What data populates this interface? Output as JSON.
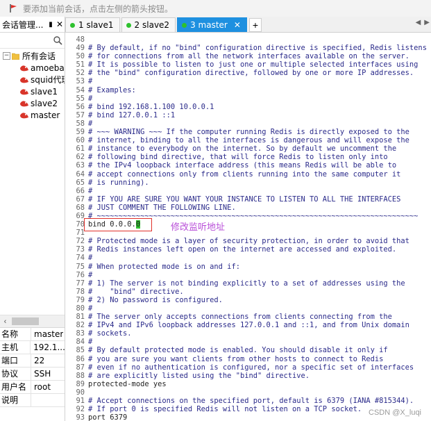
{
  "hint_bar": {
    "text": "要添加当前会话，点击左侧的箭头按钮。",
    "icon": "flag-arrow-icon"
  },
  "session_panel": {
    "title": "会话管理...",
    "pin_icon": "pin-icon",
    "close_icon": "close-icon",
    "search": {
      "value": "",
      "placeholder": ""
    },
    "tree": {
      "root": "所有会话",
      "items": [
        "amoeba",
        "squid代理",
        "slave1",
        "slave2",
        "master"
      ]
    }
  },
  "properties": [
    {
      "key": "名称",
      "value": "master"
    },
    {
      "key": "主机",
      "value": "192.1..."
    },
    {
      "key": "端口",
      "value": "22"
    },
    {
      "key": "协议",
      "value": "SSH"
    },
    {
      "key": "用户名",
      "value": "root"
    },
    {
      "key": "说明",
      "value": ""
    }
  ],
  "tabs": [
    {
      "number": "1",
      "label": "slave1",
      "active": false
    },
    {
      "number": "2",
      "label": "slave2",
      "active": false
    },
    {
      "number": "3",
      "label": "master",
      "active": true
    }
  ],
  "tab_add": "+",
  "editor": {
    "lines": [
      {
        "n": "48",
        "t": ""
      },
      {
        "n": "49",
        "t": "# By default, if no \"bind\" configuration directive is specified, Redis listens"
      },
      {
        "n": "50",
        "t": "# for connections from all the network interfaces available on the server."
      },
      {
        "n": "51",
        "t": "# It is possible to listen to just one or multiple selected interfaces using"
      },
      {
        "n": "52",
        "t": "# the \"bind\" configuration directive, followed by one or more IP addresses."
      },
      {
        "n": "53",
        "t": "#"
      },
      {
        "n": "54",
        "t": "# Examples:"
      },
      {
        "n": "55",
        "t": "#"
      },
      {
        "n": "56",
        "t": "# bind 192.168.1.100 10.0.0.1"
      },
      {
        "n": "57",
        "t": "# bind 127.0.0.1 ::1"
      },
      {
        "n": "58",
        "t": "#"
      },
      {
        "n": "59",
        "t": "# ~~~ WARNING ~~~ If the computer running Redis is directly exposed to the"
      },
      {
        "n": "60",
        "t": "# internet, binding to all the interfaces is dangerous and will expose the"
      },
      {
        "n": "61",
        "t": "# instance to everybody on the internet. So by default we uncomment the"
      },
      {
        "n": "62",
        "t": "# following bind directive, that will force Redis to listen only into"
      },
      {
        "n": "63",
        "t": "# the IPv4 loopback interface address (this means Redis will be able to"
      },
      {
        "n": "64",
        "t": "# accept connections only from clients running into the same computer it"
      },
      {
        "n": "65",
        "t": "# is running)."
      },
      {
        "n": "66",
        "t": "#"
      },
      {
        "n": "67",
        "t": "# IF YOU ARE SURE YOU WANT YOUR INSTANCE TO LISTEN TO ALL THE INTERFACES"
      },
      {
        "n": "68",
        "t": "# JUST COMMENT THE FOLLOWING LINE."
      },
      {
        "n": "69",
        "t": "# ~~~~~~~~~~~~~~~~~~~~~~~~~~~~~~~~~~~~~~~~~~~~~~~~~~~~~~~~~~~~~~~~~~~~~~~~~~"
      },
      {
        "n": "70",
        "t": "bind 0.0.0.",
        "cursor": "0"
      },
      {
        "n": "71",
        "t": ""
      },
      {
        "n": "72",
        "t": "# Protected mode is a layer of security protection, in order to avoid that"
      },
      {
        "n": "73",
        "t": "# Redis instances left open on the internet are accessed and exploited."
      },
      {
        "n": "74",
        "t": "#"
      },
      {
        "n": "75",
        "t": "# When protected mode is on and if:"
      },
      {
        "n": "76",
        "t": "#"
      },
      {
        "n": "77",
        "t": "# 1) The server is not binding explicitly to a set of addresses using the"
      },
      {
        "n": "78",
        "t": "#    \"bind\" directive."
      },
      {
        "n": "79",
        "t": "# 2) No password is configured."
      },
      {
        "n": "80",
        "t": "#"
      },
      {
        "n": "81",
        "t": "# The server only accepts connections from clients connecting from the"
      },
      {
        "n": "82",
        "t": "# IPv4 and IPv6 loopback addresses 127.0.0.1 and ::1, and from Unix domain"
      },
      {
        "n": "83",
        "t": "# sockets."
      },
      {
        "n": "84",
        "t": "#"
      },
      {
        "n": "85",
        "t": "# By default protected mode is enabled. You should disable it only if"
      },
      {
        "n": "86",
        "t": "# you are sure you want clients from other hosts to connect to Redis"
      },
      {
        "n": "87",
        "t": "# even if no authentication is configured, nor a specific set of interfaces"
      },
      {
        "n": "88",
        "t": "# are explicitly listed using the \"bind\" directive."
      },
      {
        "n": "89",
        "t": "protected-mode yes"
      },
      {
        "n": "90",
        "t": ""
      },
      {
        "n": "91",
        "t": "# Accept connections on the specified port, default is 6379 (IANA #815344)."
      },
      {
        "n": "92",
        "t": "# If port 0 is specified Redis will not listen on a TCP socket."
      },
      {
        "n": "93",
        "t": "port 6379"
      }
    ]
  },
  "annotation": "修改监听地址",
  "watermark": "CSDN @X_luqi",
  "colors": {
    "active_tab": "#1e90e0",
    "status_dot": "#2ec12e",
    "annotation": "#b84dd8",
    "highlight_box": "#e0302a"
  }
}
